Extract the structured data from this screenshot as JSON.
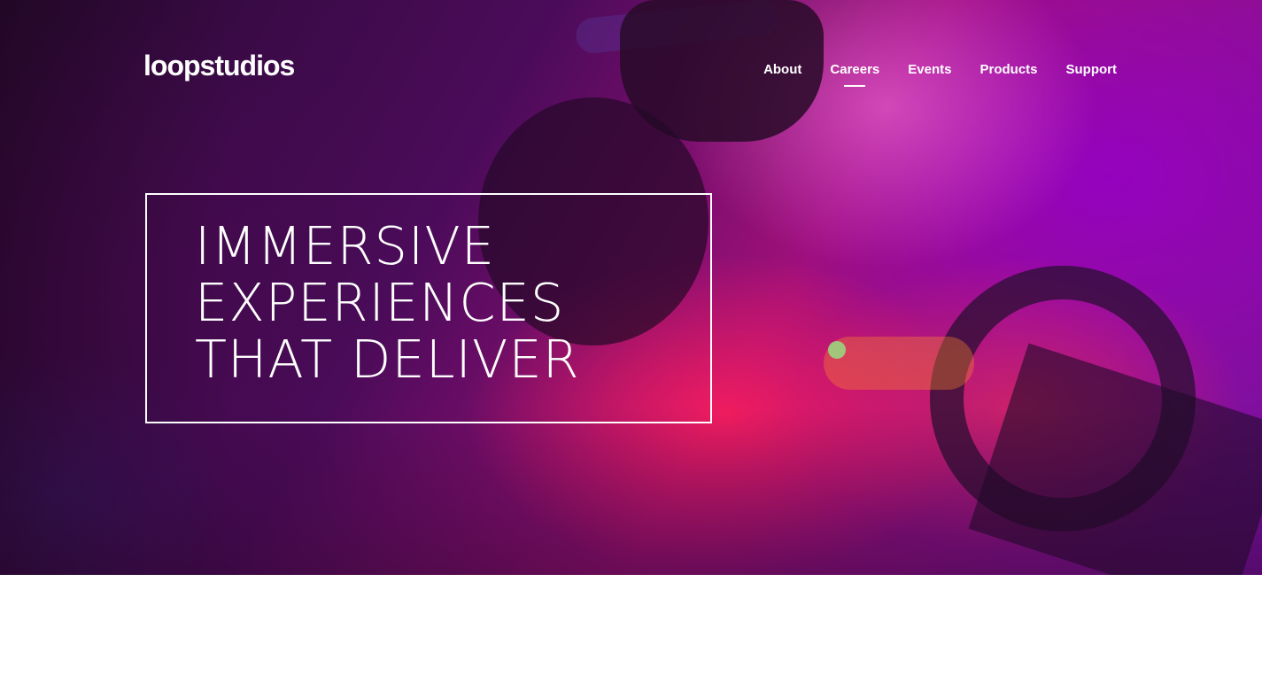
{
  "header": {
    "logo_text": "loopstudios",
    "nav": [
      {
        "label": "About",
        "active": false
      },
      {
        "label": "Careers",
        "active": true
      },
      {
        "label": "Events",
        "active": false
      },
      {
        "label": "Products",
        "active": false
      },
      {
        "label": "Support",
        "active": false
      }
    ]
  },
  "hero": {
    "headline_lines": [
      "IMMERSIVE",
      "EXPERIENCES",
      "THAT DELIVER"
    ]
  },
  "colors": {
    "text": "#ffffff",
    "hero_accent_pink": "#e0107a",
    "hero_accent_purple": "#7a0fa6",
    "page_background": "#ffffff"
  }
}
